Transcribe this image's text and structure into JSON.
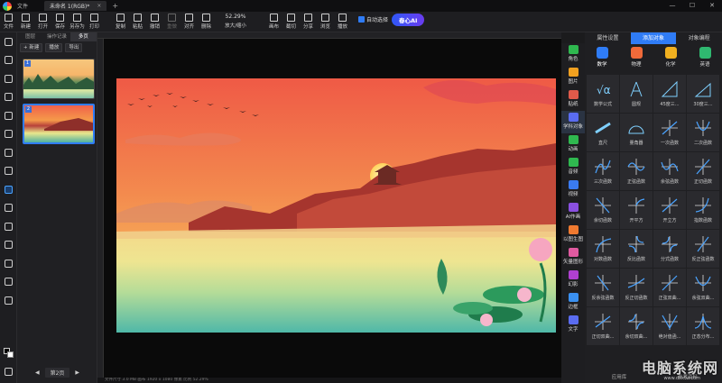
{
  "titlebar": {
    "menu": "文件",
    "tab_title": "未命名 1(RGB)*",
    "tab_close": "×",
    "new_tab": "+",
    "minimize": "—",
    "maximize": "☐",
    "close": "✕"
  },
  "toolbar": {
    "buttons": [
      "文件",
      "新建",
      "打开",
      "保存",
      "另存为",
      "打印",
      "复制",
      "粘贴",
      "撤销",
      "重做",
      "对齐",
      "删除"
    ],
    "zoom_value": "52.29%",
    "zoom_label": "放大/缩小",
    "buttons2": [
      "画布",
      "截切",
      "分享",
      "浏览",
      "播放"
    ],
    "auto_select": "自动选择",
    "ai_label": "春心AI"
  },
  "page_panel": {
    "tabs": [
      "图层",
      "操作记录",
      "多页"
    ],
    "actions": [
      "+ 新建",
      "播放",
      "导出"
    ],
    "thumbs": [
      "1",
      "2"
    ],
    "footer_page": "第2页"
  },
  "categories": [
    "角色",
    "图片",
    "贴纸",
    "学科对象",
    "动画",
    "音频",
    "视频",
    "AI作画",
    "以图生图",
    "矢量图形",
    "幻影",
    "边框",
    "文字"
  ],
  "category_colors": [
    "#2fb84f",
    "#f0a020",
    "#e05a4a",
    "#5a6cf0",
    "#2fb84f",
    "#2fb84f",
    "#3a7bf0",
    "#8a50e0",
    "#f07a30",
    "#e05aa0",
    "#b040d0",
    "#3a90f0",
    "#5a6cf0"
  ],
  "right_panel": {
    "tabs": [
      "属性设置",
      "添加对象",
      "对象编程"
    ],
    "subjects": [
      "数学",
      "物理",
      "化学",
      "英语"
    ],
    "subject_colors": [
      "#2f7cf6",
      "#f06a3a",
      "#f0b020",
      "#2fb870"
    ],
    "items": [
      "数学公式",
      "圆规",
      "45度三...",
      "30度三...",
      "直尺",
      "量角器",
      "一次函数",
      "二次函数",
      "三次函数",
      "正弦函数",
      "余弦函数",
      "正切函数",
      "余切函数",
      "开平方",
      "开立方",
      "指数函数",
      "对数函数",
      "反比函数",
      "分式函数",
      "反正弦函数",
      "反余弦函数",
      "反正切函数",
      "正弦双曲...",
      "余弦双曲...",
      "正切双曲...",
      "余切双曲...",
      "绝对值函...",
      "正态分布..."
    ],
    "footer": [
      "应用库",
      "参考资料"
    ]
  },
  "statusbar": "文件尺寸 3.0 MB  画布 1920 x 1080  像素  比例 52.29%",
  "watermark": "电脑系统网",
  "watermark_url": "www.dnxtw.com"
}
